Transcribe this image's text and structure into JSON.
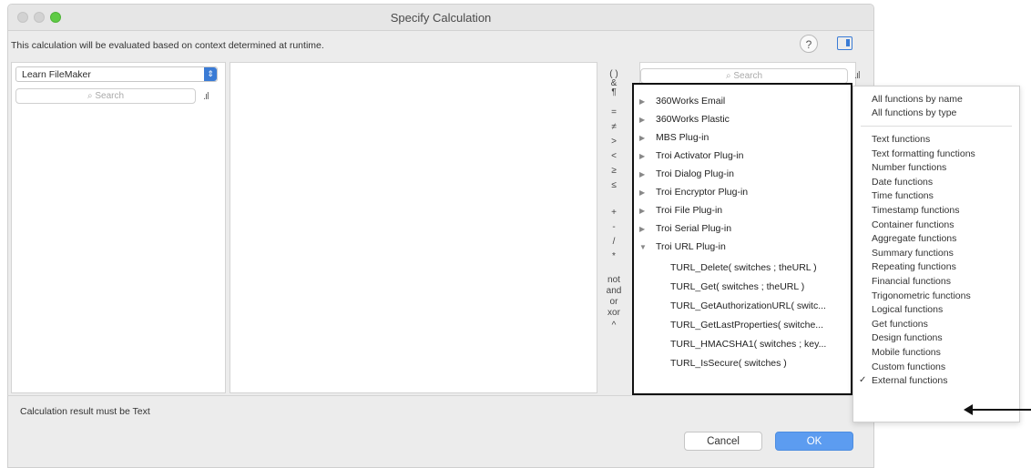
{
  "window": {
    "title": "Specify Calculation"
  },
  "header": {
    "subtitle": "This calculation will be evaluated based on context determined at runtime.",
    "help_label": "?"
  },
  "left": {
    "table_popup": "Learn FileMaker",
    "search_placeholder": "Search"
  },
  "operators": [
    "( )",
    "&",
    "¶",
    "=",
    "≠",
    ">",
    "<",
    "≥",
    "≤",
    "+",
    "-",
    "/",
    "*",
    "not",
    "and",
    "or",
    "xor",
    "^"
  ],
  "functions": {
    "search_placeholder": "Search",
    "groups": [
      {
        "label": "360Works Email",
        "expanded": false
      },
      {
        "label": "360Works Plastic",
        "expanded": false
      },
      {
        "label": "MBS Plug-in",
        "expanded": false
      },
      {
        "label": "Troi Activator Plug-in",
        "expanded": false
      },
      {
        "label": "Troi Dialog Plug-in",
        "expanded": false
      },
      {
        "label": "Troi Encryptor Plug-in",
        "expanded": false
      },
      {
        "label": "Troi File Plug-in",
        "expanded": false
      },
      {
        "label": "Troi Serial Plug-in",
        "expanded": false
      },
      {
        "label": "Troi URL Plug-in",
        "expanded": true
      }
    ],
    "children": [
      "TURL_Delete( switches ; theURL )",
      "TURL_Get( switches ; theURL )",
      "TURL_GetAuthorizationURL( switc...",
      "TURL_GetLastProperties( switche...",
      "TURL_HMACSHA1( switches ; key...",
      "TURL_IsSecure( switches )"
    ]
  },
  "menu": {
    "top_items": [
      "All functions by name",
      "All functions by type"
    ],
    "items": [
      "Text functions",
      "Text formatting functions",
      "Number functions",
      "Date functions",
      "Time functions",
      "Timestamp functions",
      "Container functions",
      "Aggregate functions",
      "Summary functions",
      "Repeating functions",
      "Financial functions",
      "Trigonometric functions",
      "Logical functions",
      "Get functions",
      "Design functions",
      "Mobile functions",
      "Custom functions",
      "External functions"
    ],
    "checked_item": "External functions",
    "check_mark": "✓"
  },
  "footer": {
    "result_label": "Calculation result must be Text",
    "cancel_label": "Cancel",
    "ok_label": "OK"
  },
  "colors": {
    "accent": "#3a7bd5",
    "ok_button": "#5c9cf0"
  }
}
